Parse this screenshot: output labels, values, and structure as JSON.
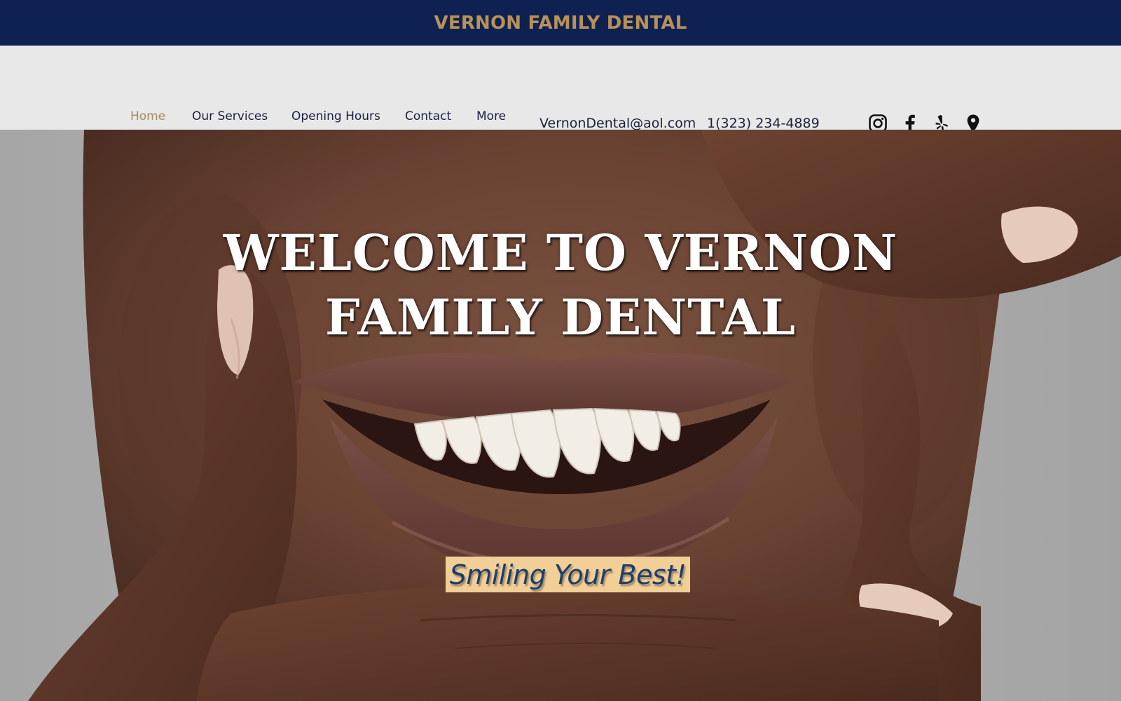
{
  "header": {
    "brand": "VERNON FAMILY DENTAL"
  },
  "nav": {
    "items": [
      {
        "label": "Home",
        "active": true
      },
      {
        "label": "Our Services",
        "active": false
      },
      {
        "label": "Opening Hours",
        "active": false
      },
      {
        "label": "Contact",
        "active": false
      },
      {
        "label": "More",
        "active": false
      }
    ],
    "email": "VernonDental@aol.com",
    "phone": "1(323) 234-4889",
    "social": [
      "instagram-icon",
      "facebook-icon",
      "yelp-icon",
      "map-pin-icon"
    ]
  },
  "hero": {
    "headline_line1": "WELCOME TO VERNON",
    "headline_line2": "FAMILY DENTAL",
    "tagline": "Smiling Your Best!"
  },
  "colors": {
    "topbar": "#0f2151",
    "brand_gold": "#b89159",
    "nav_bg": "#e8e8e8",
    "nav_text": "#1a1f3d",
    "nav_active": "#a98a5c",
    "tagline_bg": "#f1cf97",
    "tagline_text": "#1d3d6c"
  }
}
